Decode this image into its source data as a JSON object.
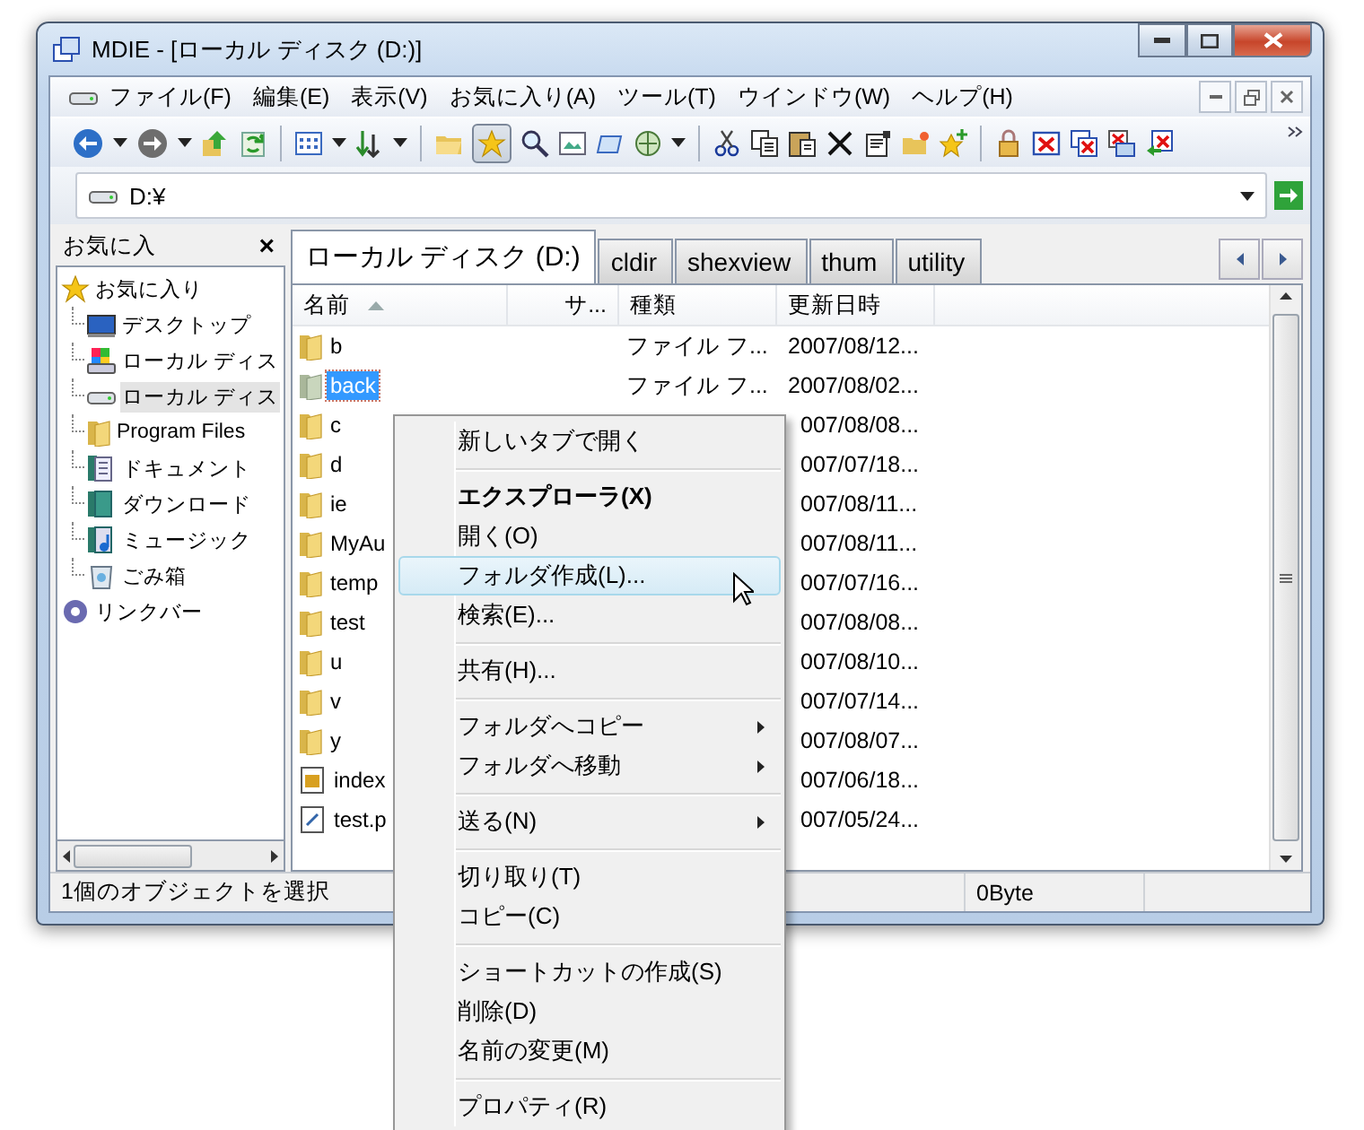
{
  "window": {
    "title": "MDIE - [ローカル ディスク (D:)]"
  },
  "menu_bar": [
    "ファイル(F)",
    "編集(E)",
    "表示(V)",
    "お気に入り(A)",
    "ツール(T)",
    "ウインドウ(W)",
    "ヘルプ(H)"
  ],
  "address_bar": {
    "value": "D:¥"
  },
  "sidebar": {
    "title": "お気に入",
    "close": "×",
    "items": [
      {
        "label": "お気に入り",
        "kind": "favorites",
        "selected": false,
        "children": [
          {
            "label": "デスクトップ",
            "kind": "desktop",
            "selected": false
          },
          {
            "label": "ローカル ディス",
            "kind": "computer",
            "selected": false
          },
          {
            "label": "ローカル ディス",
            "kind": "drive",
            "selected": true
          },
          {
            "label": "Program Files",
            "kind": "folder",
            "selected": false
          },
          {
            "label": "ドキュメント",
            "kind": "document",
            "selected": false
          },
          {
            "label": "ダウンロード",
            "kind": "download",
            "selected": false
          },
          {
            "label": "ミュージック",
            "kind": "music",
            "selected": false
          },
          {
            "label": "ごみ箱",
            "kind": "trash",
            "selected": false
          }
        ]
      },
      {
        "label": "リンクバー",
        "kind": "links",
        "selected": false
      }
    ]
  },
  "tabs": [
    {
      "label": "ローカル ディスク (D:)",
      "selected": true
    },
    {
      "label": "cldir",
      "selected": false
    },
    {
      "label": "shexview",
      "selected": false
    },
    {
      "label": "thum",
      "selected": false
    },
    {
      "label": "utility",
      "selected": false
    }
  ],
  "table": {
    "columns": [
      {
        "label": "名前",
        "sorted": true
      },
      {
        "label": "サ...",
        "sorted": false
      },
      {
        "label": "種類",
        "sorted": false
      },
      {
        "label": "更新日時",
        "sorted": false
      }
    ],
    "rows": [
      {
        "name": "b",
        "kind": "folder",
        "type": "ファイル フ...",
        "date": "2007/08/12...",
        "selected": false
      },
      {
        "name": "back",
        "kind": "folder",
        "type": "ファイル フ...",
        "date": "2007/08/02...",
        "selected": true
      },
      {
        "name": "c",
        "kind": "folder",
        "date": "007/08/08...",
        "selected": false
      },
      {
        "name": "d",
        "kind": "folder",
        "date": "007/07/18...",
        "selected": false
      },
      {
        "name": "ie",
        "kind": "folder",
        "date": "007/08/11...",
        "selected": false
      },
      {
        "name": "MyAu",
        "kind": "folder",
        "date": "007/08/11...",
        "selected": false
      },
      {
        "name": "temp",
        "kind": "folder",
        "date": "007/07/16...",
        "selected": false
      },
      {
        "name": "test",
        "kind": "folder",
        "date": "007/08/08...",
        "selected": false
      },
      {
        "name": "u",
        "kind": "folder",
        "date": "007/08/10...",
        "selected": false
      },
      {
        "name": "v",
        "kind": "folder",
        "date": "007/07/14...",
        "selected": false
      },
      {
        "name": "y",
        "kind": "folder",
        "date": "007/08/07...",
        "selected": false
      },
      {
        "name": "index",
        "kind": "image",
        "date": "007/06/18...",
        "selected": false
      },
      {
        "name": "test.p",
        "kind": "text",
        "date": "007/05/24...",
        "selected": false
      }
    ]
  },
  "status_bar": [
    "1個のオブジェクトを選択",
    "0Byte"
  ],
  "context_menu": {
    "groups": [
      [
        {
          "label": "新しいタブで開く",
          "default": false,
          "submenu": false,
          "highlighted": false
        }
      ],
      [
        {
          "label": "エクスプローラ(X)",
          "default": true,
          "submenu": false,
          "highlighted": false
        },
        {
          "label": "開く(O)",
          "default": false,
          "submenu": false,
          "highlighted": false
        },
        {
          "label": "フォルダ作成(L)...",
          "default": false,
          "submenu": false,
          "highlighted": true
        },
        {
          "label": "検索(E)...",
          "default": false,
          "submenu": false,
          "highlighted": false
        }
      ],
      [
        {
          "label": "共有(H)...",
          "default": false,
          "submenu": false,
          "highlighted": false
        }
      ],
      [
        {
          "label": "フォルダへコピー",
          "default": false,
          "submenu": true,
          "highlighted": false
        },
        {
          "label": "フォルダへ移動",
          "default": false,
          "submenu": true,
          "highlighted": false
        }
      ],
      [
        {
          "label": "送る(N)",
          "default": false,
          "submenu": true,
          "highlighted": false
        }
      ],
      [
        {
          "label": "切り取り(T)",
          "default": false,
          "submenu": false,
          "highlighted": false
        },
        {
          "label": "コピー(C)",
          "default": false,
          "submenu": false,
          "highlighted": false
        }
      ],
      [
        {
          "label": "ショートカットの作成(S)",
          "default": false,
          "submenu": false,
          "highlighted": false
        },
        {
          "label": "削除(D)",
          "default": false,
          "submenu": false,
          "highlighted": false
        },
        {
          "label": "名前の変更(M)",
          "default": false,
          "submenu": false,
          "highlighted": false
        }
      ],
      [
        {
          "label": "プロパティ(R)",
          "default": false,
          "submenu": false,
          "highlighted": false
        }
      ]
    ]
  }
}
